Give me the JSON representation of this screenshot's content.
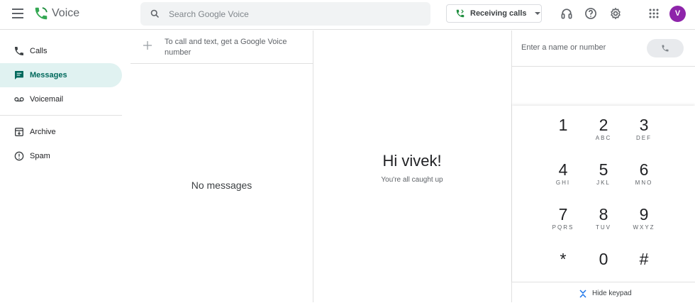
{
  "app": {
    "name": "Voice"
  },
  "search": {
    "placeholder": "Search Google Voice"
  },
  "status": {
    "receiving_label": "Receiving calls"
  },
  "avatar": {
    "initial": "V",
    "color": "#8e24aa"
  },
  "nav": {
    "items": [
      {
        "label": "Calls",
        "icon": "phone-icon"
      },
      {
        "label": "Messages",
        "icon": "message-icon",
        "active": true
      },
      {
        "label": "Voicemail",
        "icon": "voicemail-icon"
      },
      {
        "label": "Archive",
        "icon": "archive-icon"
      },
      {
        "label": "Spam",
        "icon": "spam-icon"
      }
    ]
  },
  "messages": {
    "compose_text": "To call and text, get a Google Voice number",
    "empty_text": "No messages"
  },
  "center": {
    "greeting": "Hi vivek!",
    "subtext": "You're all caught up"
  },
  "dialer": {
    "placeholder": "Enter a name or number",
    "keys": [
      {
        "digit": "1",
        "letters": ""
      },
      {
        "digit": "2",
        "letters": "ABC"
      },
      {
        "digit": "3",
        "letters": "DEF"
      },
      {
        "digit": "4",
        "letters": "GHI"
      },
      {
        "digit": "5",
        "letters": "JKL"
      },
      {
        "digit": "6",
        "letters": "MNO"
      },
      {
        "digit": "7",
        "letters": "PQRS"
      },
      {
        "digit": "8",
        "letters": "TUV"
      },
      {
        "digit": "9",
        "letters": "WXYZ"
      },
      {
        "digit": "*",
        "letters": ""
      },
      {
        "digit": "0",
        "letters": ""
      },
      {
        "digit": "#",
        "letters": ""
      }
    ],
    "hide_keypad_label": "Hide keypad"
  },
  "colors": {
    "accent": "#00695c",
    "active_bg": "#e0f2f1",
    "brand_green": "#34a853"
  }
}
